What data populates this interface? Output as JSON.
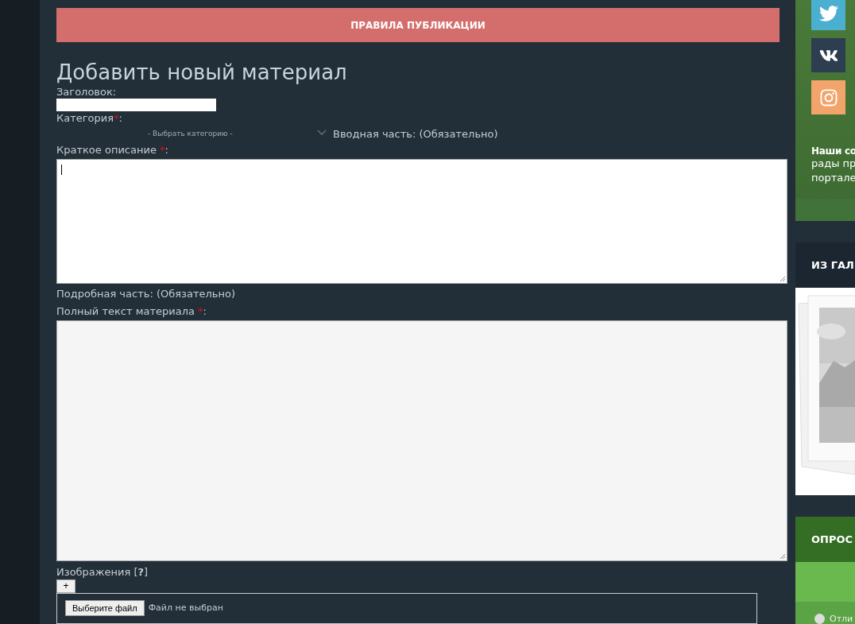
{
  "banner": {
    "label": "ПРАВИЛА ПУБЛИКАЦИИ"
  },
  "heading": "Добавить новый материал",
  "title_field": {
    "label": "Заголовок:"
  },
  "required_mark": "*",
  "label_suffix": ":",
  "category": {
    "label": "Категория",
    "required": true,
    "value": "- Выбрать категорию -"
  },
  "intro_note": "Вводная часть: (Обязательно)",
  "short_description": {
    "label": "Краткое описание",
    "required": true,
    "focused": true
  },
  "detail_note": "Подробная часть: (Обязательно)",
  "full_text": {
    "label": "Полный текст материала",
    "required": true
  },
  "images": {
    "label": "Изображения [**?**]",
    "add_button": "+",
    "file_button": "Выберите файл",
    "file_status": "Файл не выбран"
  },
  "sidebar": {
    "social": [
      {
        "kind": "twitter",
        "color": "#4bafcf"
      },
      {
        "kind": "vk",
        "color": "#2c3e50"
      },
      {
        "kind": "instagram",
        "color": "#f2a46a"
      }
    ],
    "note_bold": "Наши со",
    "note_lines": [
      "рады пр",
      "портале"
    ],
    "gallery_title": "ИЗ ГАЛ",
    "poll_title": "ОПРОС",
    "poll_options": [
      {
        "label": "Отли",
        "selected": false
      }
    ]
  }
}
